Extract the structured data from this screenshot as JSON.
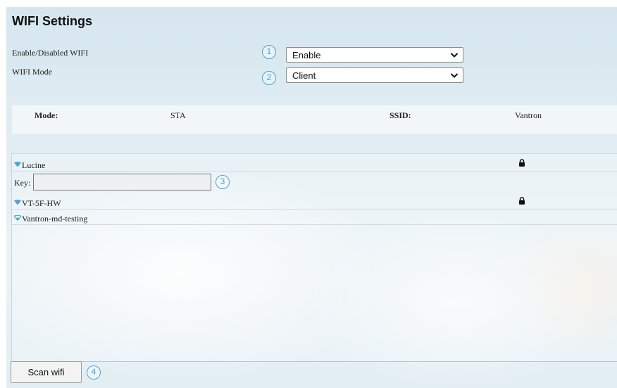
{
  "page": {
    "title": "WIFI Settings"
  },
  "settings": {
    "enable_label": "Enable/Disabled WIFI",
    "enable_value": "Enable",
    "mode_label": "WIFI Mode",
    "mode_value": "Client"
  },
  "status": {
    "mode_key": "Mode:",
    "mode_value": "STA",
    "ssid_key": "SSID:",
    "ssid_value": "Vantron"
  },
  "networks": [
    {
      "name": "Lucine",
      "locked": true
    },
    {
      "name": "VT-5F-HW",
      "locked": true
    },
    {
      "name": "Vantron-md-testing",
      "locked": false
    }
  ],
  "key": {
    "label": "Key:",
    "value": ""
  },
  "actions": {
    "scan_label": "Scan wifi"
  },
  "callouts": [
    "1",
    "2",
    "3",
    "4"
  ],
  "colors": {
    "callout": "#4aa3d4",
    "wifi_icon": "#4aa3d4"
  },
  "icons": {
    "wifi": "wifi-icon",
    "lock": "lock-icon",
    "dropdown": "chevron-down-icon"
  }
}
